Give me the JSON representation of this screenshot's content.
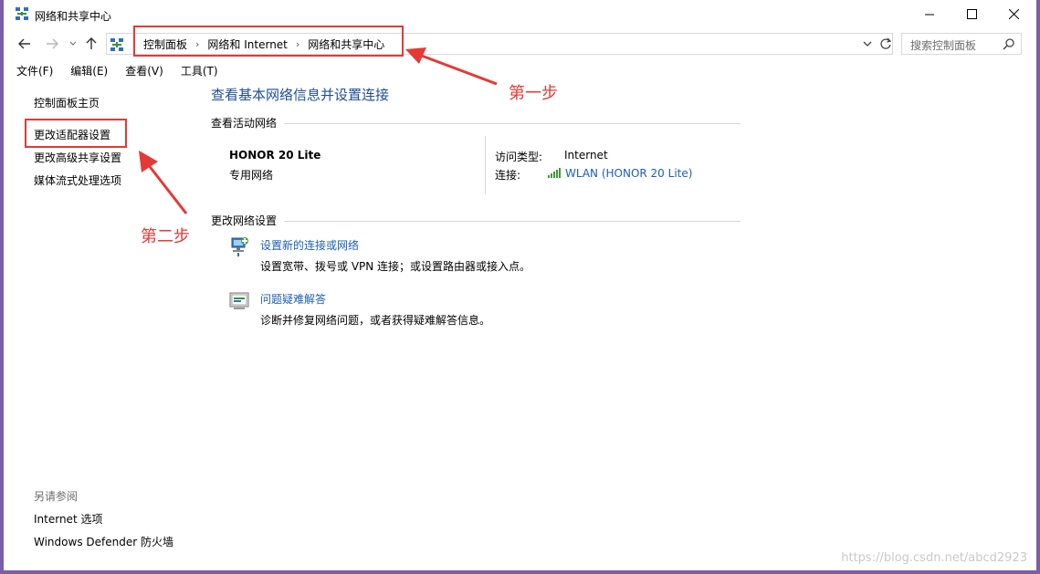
{
  "window": {
    "title": "网络和共享中心",
    "controls": {
      "minimize": "minimize-icon",
      "maximize": "maximize-icon",
      "close": "close-icon"
    }
  },
  "address_bar": {
    "breadcrumbs": [
      "控制面板",
      "网络和 Internet",
      "网络和共享中心"
    ],
    "search_placeholder": "搜索控制面板"
  },
  "menu": [
    "文件(F)",
    "编辑(E)",
    "查看(V)",
    "工具(T)"
  ],
  "sidebar": {
    "home": "控制面板主页",
    "links": [
      "更改适配器设置",
      "更改高级共享设置",
      "媒体流式处理选项"
    ],
    "see_also_title": "另请参阅",
    "see_also": [
      "Internet 选项",
      "Windows Defender 防火墙"
    ]
  },
  "main": {
    "title": "查看基本网络信息并设置连接",
    "active_networks_heading": "查看活动网络",
    "network": {
      "name": "HONOR 20 Lite",
      "category": "专用网络",
      "access_type_label": "访问类型:",
      "access_type_value": "Internet",
      "connection_label": "连接:",
      "connection_value": "WLAN (HONOR 20 Lite)"
    },
    "change_settings_heading": "更改网络设置",
    "tasks": [
      {
        "link": "设置新的连接或网络",
        "desc": "设置宽带、拨号或 VPN 连接；或设置路由器或接入点。",
        "icon": "network-setup-icon"
      },
      {
        "link": "问题疑难解答",
        "desc": "诊断并修复网络问题，或者获得疑难解答信息。",
        "icon": "troubleshoot-icon"
      }
    ]
  },
  "annotations": {
    "step1": "第一步",
    "step2": "第二步",
    "color": "#e53935"
  },
  "watermark": "https://blog.csdn.net/abcd2923"
}
